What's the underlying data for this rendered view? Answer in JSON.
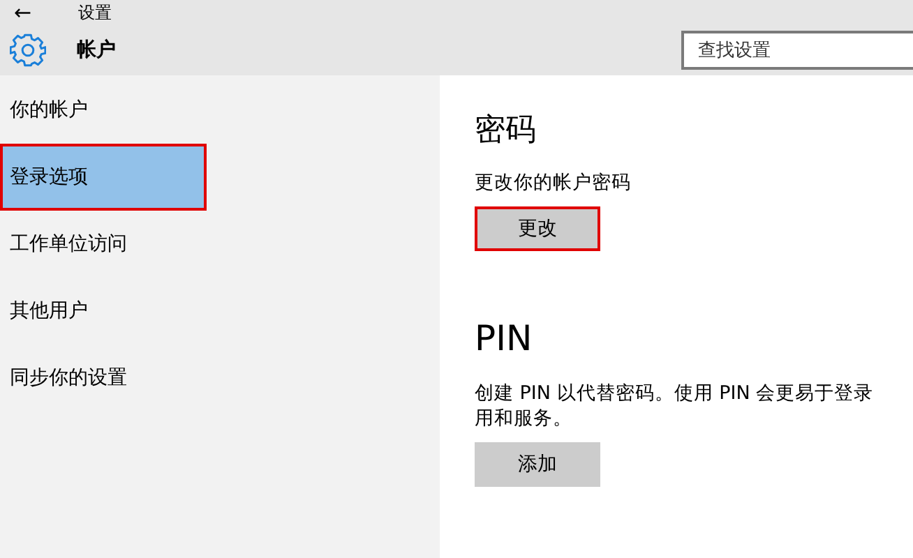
{
  "window": {
    "back": "←",
    "title": "设置"
  },
  "header": {
    "title": "帐户",
    "search": {
      "placeholder": "查找设置"
    }
  },
  "sidebar": {
    "items": [
      {
        "label": "你的帐户",
        "selected": false,
        "highlighted": false
      },
      {
        "label": "登录选项",
        "selected": true,
        "highlighted": true
      },
      {
        "label": "工作单位访问",
        "selected": false,
        "highlighted": false
      },
      {
        "label": "其他用户",
        "selected": false,
        "highlighted": false
      },
      {
        "label": "同步你的设置",
        "selected": false,
        "highlighted": false
      }
    ]
  },
  "sections": [
    {
      "heading": "密码",
      "lines": [
        "更改你的帐户密码"
      ],
      "button": {
        "label": "更改",
        "highlighted": true
      }
    },
    {
      "heading": "PIN",
      "lines": [
        "创建 PIN 以代替密码。使用 PIN 会更易于登录",
        "用和服务。"
      ],
      "button": {
        "label": "添加",
        "highlighted": false
      }
    }
  ]
}
